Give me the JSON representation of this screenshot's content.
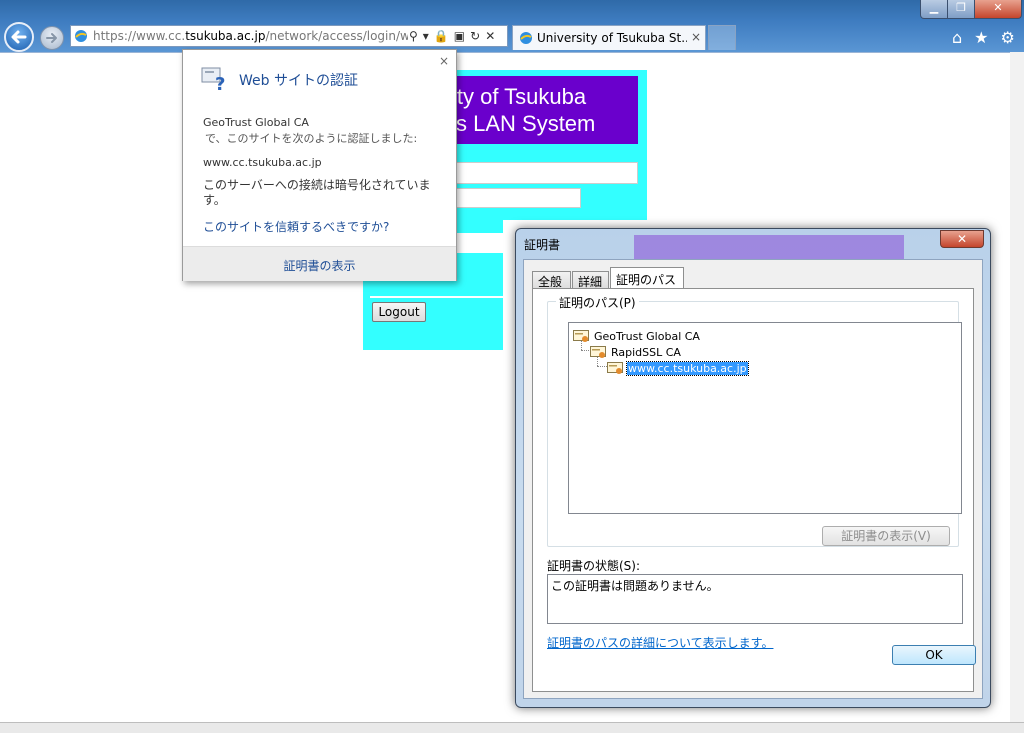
{
  "browser": {
    "address_prefix": "https://www.cc.",
    "address_domain": "tsukuba.ac.jp",
    "address_suffix": "/network/access/login/w",
    "tab_title": "University of Tsukuba St...",
    "tab_close": "×"
  },
  "page": {
    "header_line1": "ity of Tsukuba",
    "header_line2": "s LAN System",
    "logout_label": "Logout"
  },
  "site_id_popup": {
    "title": "Web サイトの認証",
    "close": "×",
    "issuer": "GeoTrust Global CA",
    "issuer_desc": "で、このサイトを次のように認証しました:",
    "site": "www.cc.tsukuba.ac.jp",
    "encryption_note": "このサーバーへの接続は暗号化されています。",
    "trust_link": "このサイトを信頼するべきですか?",
    "view_cert": "証明書の表示"
  },
  "cert_dialog": {
    "title": "証明書",
    "close": "✕",
    "tabs": [
      "全般",
      "詳細",
      "証明のパス"
    ],
    "active_tab": "証明のパス",
    "path_group_label": "証明のパス(P)",
    "path_nodes": [
      {
        "label": "GeoTrust Global CA",
        "selected": false
      },
      {
        "label": "RapidSSL CA",
        "selected": false
      },
      {
        "label": "www.cc.tsukuba.ac.jp",
        "selected": true
      }
    ],
    "view_cert_button": "証明書の表示(V)",
    "status_label": "証明書の状態(S):",
    "status_text": "この証明書は問題ありません。",
    "path_details_link": "証明書のパスの詳細について表示します。",
    "ok_button": "OK"
  }
}
